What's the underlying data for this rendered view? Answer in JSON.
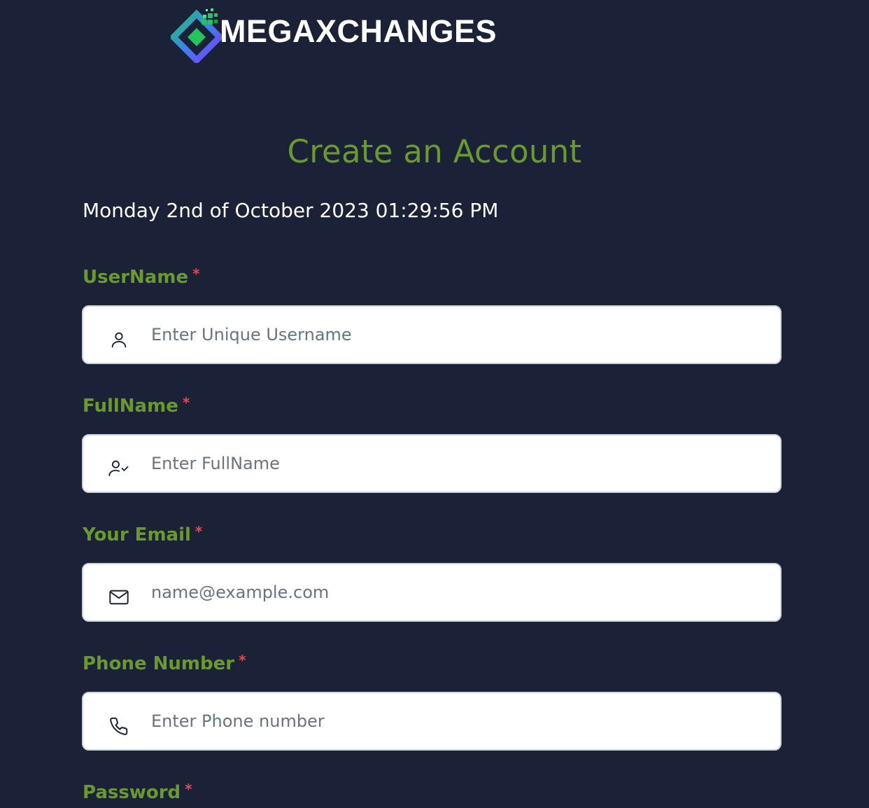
{
  "brand": {
    "name": "MEGAXCHANGES",
    "logo_icon": "diamond-pixel-logo-icon",
    "colors": {
      "green": "#22c55e",
      "blue": "#3b82f6",
      "purple": "#7c3aed"
    }
  },
  "page": {
    "title": "Create an Account",
    "datetime": "Monday 2nd of October 2023 01:29:56 PM"
  },
  "form": {
    "required_marker": "*",
    "username": {
      "label": "UserName",
      "placeholder": "Enter Unique Username",
      "value": "",
      "icon": "user-icon"
    },
    "fullname": {
      "label": "FullName",
      "placeholder": "Enter FullName",
      "value": "",
      "icon": "user-check-icon"
    },
    "email": {
      "label": "Your Email",
      "placeholder": "name@example.com",
      "value": "",
      "icon": "mail-icon"
    },
    "phone": {
      "label": "Phone Number",
      "placeholder": "Enter Phone number",
      "value": "",
      "icon": "phone-icon"
    },
    "password": {
      "label": "Password"
    }
  },
  "colors": {
    "background": "#1b2137",
    "label_green": "#6b9a2c",
    "required_red": "#e5484d",
    "input_bg": "#ffffff"
  }
}
